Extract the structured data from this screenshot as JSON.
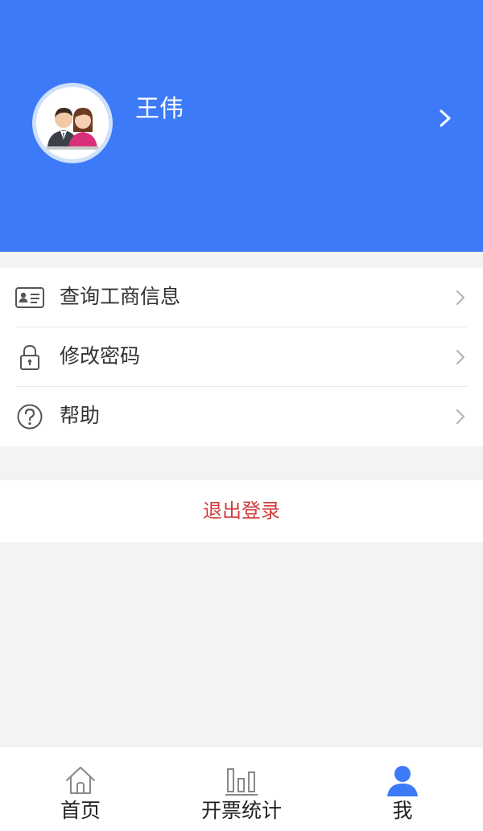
{
  "profile": {
    "name": "王伟",
    "avatar_icon": "couple-avatar-icon",
    "chevron_icon": "chevron-right-icon"
  },
  "menu": {
    "items": [
      {
        "label": "查询工商信息",
        "icon": "id-card-icon"
      },
      {
        "label": "修改密码",
        "icon": "lock-icon"
      },
      {
        "label": "帮助",
        "icon": "help-icon"
      }
    ]
  },
  "logout": {
    "label": "退出登录"
  },
  "tabbar": {
    "items": [
      {
        "label": "首页",
        "icon": "home-icon",
        "active": false
      },
      {
        "label": "开票统计",
        "icon": "bar-chart-icon",
        "active": false
      },
      {
        "label": "我",
        "icon": "user-icon",
        "active": true
      }
    ]
  },
  "colors": {
    "header_bg": "#3d7af7",
    "logout_text": "#d23b3b",
    "active_tab": "#3d7af7",
    "background": "#f3f3f3"
  }
}
